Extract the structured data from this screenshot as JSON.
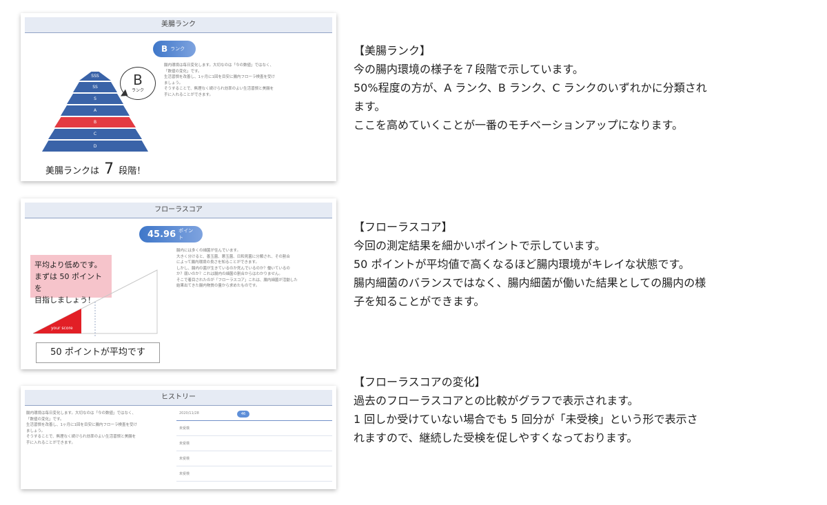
{
  "card1": {
    "header": "美腸ランク",
    "pill_main": "B",
    "pill_sub": "ランク",
    "bubble_letter": "B",
    "bubble_sub": "ランク",
    "pyramid": [
      "SSS",
      "SS",
      "S",
      "A",
      "B",
      "C",
      "D"
    ],
    "bottom_prefix": "美腸ランクは",
    "bottom_number": "7",
    "bottom_suffix": "段階！",
    "desc": "腸内環境は毎日変化します。大切なのは「今の数値」ではなく、\n「数値の変化」です。\n生活習慣を改善し、1ヶ月に1回を目安に腸内フローラ検査を受け\nましょう。\nそうすることで、無理なく続けられ効率のよい生活習慣と美腸を\n手に入れることができます。"
  },
  "card2": {
    "header": "フローラスコア",
    "pill_main": "45.96",
    "pill_sub": "ポイント",
    "pink_box": "平均より低めです。\nまずは 50 ポイントを\n目指しましょう！",
    "your_score": "your score",
    "callout": "50 ポイントが平均です",
    "desc": "腸内には多くの細菌が住んでいます。\n大きく分けると、善玉菌、悪玉菌、日和見菌に分類され、その割合\nによって腸内環境の良さを知ることができます。\nしかし、腸内の菌が生きているのか死んでいるのか？働いているの\nか？弱いのか？これは腸内の細菌の割合からはわかりません。\nそこで着目されたのが「フローラスコア」これは、腸内細菌が活動した\n結果出てきた腸内物質の量から求めたものです。"
  },
  "card3": {
    "header": "ヒストリー",
    "desc": "腸内環境は毎日変化します。大切なのは「今の数値」ではなく、\n「数値の変化」です。\n生活習慣を改善し、1ヶ月に1回を目安に腸内フローラ検査を受け\nましょう。\nそうすることで、無理なく続けられ効率のよい生活習慣と美腸を\n手に入れることができます。",
    "rows": [
      "2020/11/28",
      "未受検",
      "未受検",
      "未受検",
      "未受検"
    ],
    "row1_value": "46"
  },
  "sections": [
    {
      "title": "【美腸ランク】",
      "lines": [
        "今の腸内環境の様子を７段階で示しています。",
        "50%程度の方が、A ランク、B ランク、C ランクのいずれかに分類され",
        "ます。",
        "ここを高めていくことが一番のモチベーションアップになります。"
      ]
    },
    {
      "title": "【フローラスコア】",
      "lines": [
        "今回の測定結果を細かいポイントで示しています。",
        "50 ポイントが平均値で高くなるほど腸内環境がキレイな状態です。",
        "腸内細菌のバランスではなく、腸内細菌が働いた結果としての腸内の様",
        "子を知ることができます。"
      ]
    },
    {
      "title": "【フローラスコアの変化】",
      "lines": [
        "過去のフローラスコアとの比較がグラフで表示されます。",
        "1 回しか受けていない場合でも 5 回分が「未受検」という形で表示さ",
        "れますので、継続した受検を促しやすくなっております。"
      ]
    }
  ],
  "colors": {
    "pyramid_blue": "#3a63a8",
    "pyramid_red": "#e33b42",
    "pill_blue": "#3f77c9",
    "pink": "#f6c4cb",
    "score_red": "#e21f26"
  }
}
